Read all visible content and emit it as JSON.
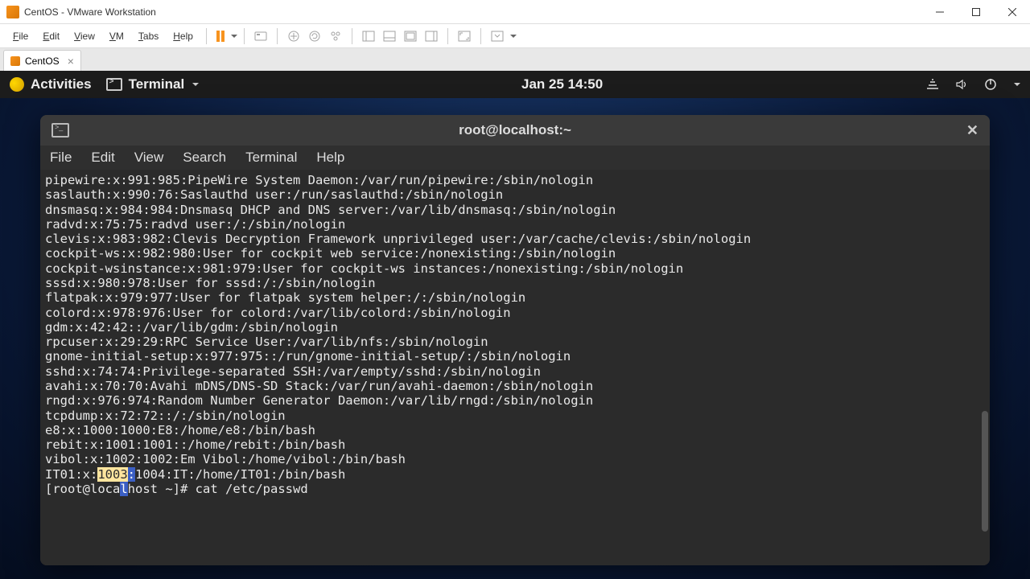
{
  "windows_title": "CentOS - VMware Workstation",
  "vmware_menu": [
    "File",
    "Edit",
    "View",
    "VM",
    "Tabs",
    "Help"
  ],
  "vmware_tab": {
    "label": "CentOS"
  },
  "gnome": {
    "activities": "Activities",
    "app_indicator": "Terminal",
    "clock": "Jan 25  14:50"
  },
  "terminal": {
    "window_title": "root@localhost:~",
    "menu": [
      "File",
      "Edit",
      "View",
      "Search",
      "Terminal",
      "Help"
    ],
    "lines": [
      "pipewire:x:991:985:PipeWire System Daemon:/var/run/pipewire:/sbin/nologin",
      "saslauth:x:990:76:Saslauthd user:/run/saslauthd:/sbin/nologin",
      "dnsmasq:x:984:984:Dnsmasq DHCP and DNS server:/var/lib/dnsmasq:/sbin/nologin",
      "radvd:x:75:75:radvd user:/:/sbin/nologin",
      "clevis:x:983:982:Clevis Decryption Framework unprivileged user:/var/cache/clevis:/sbin/nologin",
      "cockpit-ws:x:982:980:User for cockpit web service:/nonexisting:/sbin/nologin",
      "cockpit-wsinstance:x:981:979:User for cockpit-ws instances:/nonexisting:/sbin/nologin",
      "sssd:x:980:978:User for sssd:/:/sbin/nologin",
      "flatpak:x:979:977:User for flatpak system helper:/:/sbin/nologin",
      "colord:x:978:976:User for colord:/var/lib/colord:/sbin/nologin",
      "gdm:x:42:42::/var/lib/gdm:/sbin/nologin",
      "rpcuser:x:29:29:RPC Service User:/var/lib/nfs:/sbin/nologin",
      "gnome-initial-setup:x:977:975::/run/gnome-initial-setup/:/sbin/nologin",
      "sshd:x:74:74:Privilege-separated SSH:/var/empty/sshd:/sbin/nologin",
      "avahi:x:70:70:Avahi mDNS/DNS-SD Stack:/var/run/avahi-daemon:/sbin/nologin",
      "rngd:x:976:974:Random Number Generator Daemon:/var/lib/rngd:/sbin/nologin",
      "tcpdump:x:72:72::/:/sbin/nologin",
      "e8:x:1000:1000:E8:/home/e8:/bin/bash",
      "rebit:x:1001:1001::/home/rebit:/bin/bash",
      "vibol:x:1002:1002:Em Vibol:/home/vibol:/bin/bash"
    ],
    "highlight_line": {
      "pre": "IT01:x:",
      "hl_yellow": "1003",
      "hl_blue": ":",
      "post": "1004:IT:/home/IT01:/bin/bash"
    },
    "prompt_line": {
      "prompt_pre": "[root@loca",
      "prompt_blue": "l",
      "prompt_post": "host ~]# ",
      "command": "cat /etc/passwd"
    }
  }
}
